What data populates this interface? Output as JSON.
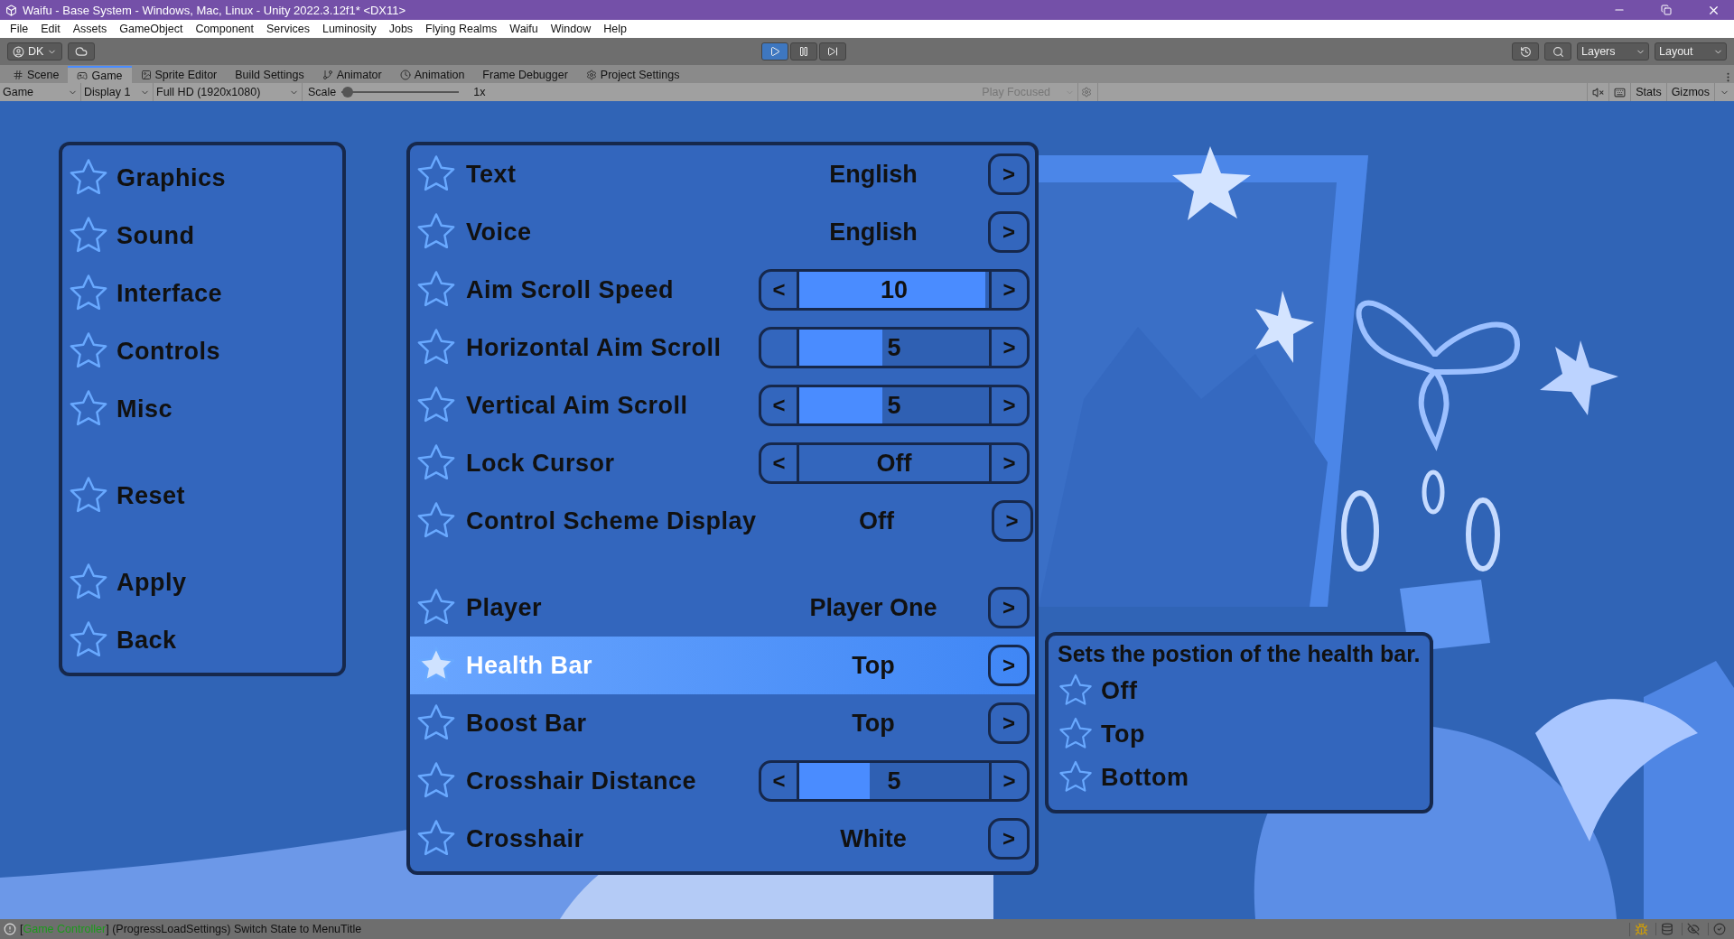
{
  "window": {
    "title": "Waifu - Base System - Windows, Mac, Linux - Unity 2022.3.12f1* <DX11>"
  },
  "menu": [
    "File",
    "Edit",
    "Assets",
    "GameObject",
    "Component",
    "Services",
    "Luminosity",
    "Jobs",
    "Flying Realms",
    "Waifu",
    "Window",
    "Help"
  ],
  "toolbar": {
    "account": "DK",
    "playing": true,
    "layers": "Layers",
    "layout": "Layout"
  },
  "tabs": [
    {
      "label": "Scene",
      "selected": false
    },
    {
      "label": "Game",
      "selected": true
    },
    {
      "label": "Sprite Editor",
      "selected": false
    },
    {
      "label": "Build Settings",
      "selected": false
    },
    {
      "label": "Animator",
      "selected": false
    },
    {
      "label": "Animation",
      "selected": false
    },
    {
      "label": "Frame Debugger",
      "selected": false
    },
    {
      "label": "Project Settings",
      "selected": false
    }
  ],
  "game_toolbar": {
    "view": "Game",
    "display": "Display 1",
    "resolution": "Full HD (1920x1080)",
    "scale_label": "Scale",
    "scale": {
      "level": 0.05
    },
    "scale_value": "1x",
    "play_mode": "Play Focused",
    "stats": "Stats",
    "gizmos": "Gizmos"
  },
  "categories": [
    {
      "items": [
        {
          "label": "Graphics"
        },
        {
          "label": "Sound"
        },
        {
          "label": "Interface"
        },
        {
          "label": "Controls"
        },
        {
          "label": "Misc"
        }
      ]
    },
    {
      "items": [
        {
          "label": "Reset"
        }
      ]
    },
    {
      "items": [
        {
          "label": "Apply"
        },
        {
          "label": "Back"
        }
      ]
    }
  ],
  "settings": [
    {
      "rows": [
        {
          "kind": "option",
          "label": "Text",
          "value": "English",
          "next": ">",
          "selected": false
        },
        {
          "kind": "option",
          "label": "Voice",
          "value": "English",
          "next": ">",
          "selected": false
        },
        {
          "kind": "slider",
          "label": "Aim Scroll Speed",
          "prev": "<",
          "value": "10",
          "level": 0.98,
          "next": ">",
          "selected": false
        },
        {
          "kind": "slider",
          "label": "Horizontal Aim Scroll",
          "value": "5",
          "level": 0.44,
          "next": ">",
          "selected": false
        },
        {
          "kind": "slider",
          "label": "Vertical Aim Scroll",
          "prev": "<",
          "value": "5",
          "level": 0.44,
          "next": ">",
          "selected": false
        },
        {
          "kind": "stepper",
          "label": "Lock Cursor",
          "prev": "<",
          "value": "Off",
          "next": ">",
          "selected": false
        },
        {
          "kind": "option",
          "label": "Control Scheme Display",
          "value": "Off",
          "next": ">",
          "selected": false
        }
      ]
    },
    {
      "rows": [
        {
          "kind": "option",
          "label": "Player",
          "value": "Player One",
          "next": ">",
          "selected": false
        },
        {
          "kind": "option",
          "label": "Health Bar",
          "value": "Top",
          "next": ">",
          "selected": true
        },
        {
          "kind": "option",
          "label": "Boost Bar",
          "value": "Top",
          "next": ">",
          "selected": false
        },
        {
          "kind": "slider",
          "label": "Crosshair Distance",
          "prev": "<",
          "value": "5",
          "level": 0.37,
          "next": ">",
          "selected": false
        },
        {
          "kind": "option",
          "label": "Crosshair",
          "value": "White",
          "next": ">",
          "selected": false
        }
      ]
    }
  ],
  "tooltip": {
    "text": "Sets the postion of the health bar.",
    "options": [
      {
        "label": "Off"
      },
      {
        "label": "Top"
      },
      {
        "label": "Bottom"
      }
    ]
  },
  "status_bar": {
    "bracket": "[",
    "source": "Game Controller",
    "message": "] (ProgressLoadSettings) Switch State to MenuTitle"
  }
}
